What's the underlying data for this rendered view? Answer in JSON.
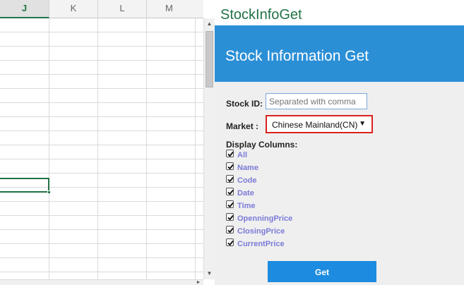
{
  "sheet": {
    "columns": [
      {
        "label": "J",
        "active": true
      },
      {
        "label": "K",
        "active": false
      },
      {
        "label": "L",
        "active": false
      },
      {
        "label": "M",
        "active": false
      }
    ]
  },
  "scroll": {
    "up_icon": "arrow-up-icon",
    "down_icon": "arrow-down-icon",
    "right_icon": "arrow-right-icon"
  },
  "pane": {
    "title": "StockInfoGet",
    "banner": "Stock Information Get",
    "stock_id_label": "Stock ID:",
    "stock_id_placeholder": "Separated with comma",
    "market_label": "Market :",
    "market_value": "Chinese Mainland(CN)",
    "display_columns_label": "Display Columns:",
    "columns": [
      {
        "label": "All",
        "checked": true
      },
      {
        "label": "Name",
        "checked": true
      },
      {
        "label": "Code",
        "checked": true
      },
      {
        "label": "Date",
        "checked": true
      },
      {
        "label": "Time",
        "checked": true
      },
      {
        "label": "OpenningPrice",
        "checked": true
      },
      {
        "label": "ClosingPrice",
        "checked": true
      },
      {
        "label": "CurrentPrice",
        "checked": true
      }
    ],
    "get_button": "Get"
  },
  "colors": {
    "accent_green": "#217346",
    "banner_blue": "#2b8fd6",
    "button_blue": "#1d8ce0",
    "highlight_red": "#d9231f",
    "checkbox_label": "#7b7bd8"
  }
}
